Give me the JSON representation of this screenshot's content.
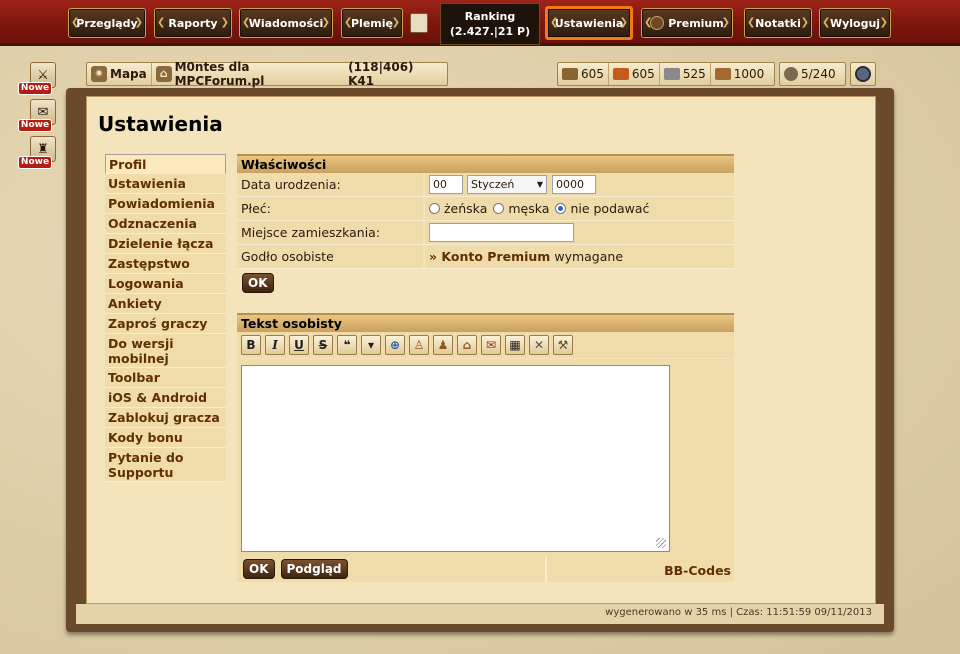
{
  "nav": {
    "buttons": {
      "overviews": "Przeglądy",
      "reports": "Raporty",
      "messages": "Wiadomości",
      "tribe": "Plemię",
      "settings": "Ustawienia",
      "premium": "Premium",
      "notes": "Notatki",
      "logout": "Wyloguj"
    },
    "ranking": {
      "label": "Ranking",
      "value": "(2.427.|21 P)"
    }
  },
  "notices": {
    "badge": "Nowe"
  },
  "village": {
    "map_label": "Mapa",
    "name": "M0ntes dla MPCForum.pl",
    "coords": "(118|406) K41"
  },
  "resources": {
    "wood": "605",
    "clay": "605",
    "iron": "525",
    "storage": "1000",
    "population": "5/240"
  },
  "page": {
    "title": "Ustawienia"
  },
  "menu": {
    "items": [
      "Profil",
      "Ustawienia",
      "Powiadomienia",
      "Odznaczenia",
      "Dzielenie łącza",
      "Zastępstwo",
      "Logowania",
      "Ankiety",
      "Zaproś graczy",
      "Do wersji mobilnej",
      "Toolbar",
      "iOS & Android",
      "Zablokuj gracza",
      "Kody bonu",
      "Pytanie do Supportu"
    ]
  },
  "properties": {
    "header": "Właściwości",
    "birthdate_label": "Data urodzenia:",
    "day": "00",
    "month": "Styczeń",
    "year": "0000",
    "gender_label": "Płeć:",
    "gender_options": [
      "żeńska",
      "męska",
      "nie podawać"
    ],
    "gender_selected": "nie podawać",
    "residence_label": "Miejsce zamieszkania:",
    "residence_value": "",
    "emblem_label": "Godło osobiste",
    "emblem_link": "» Konto Premium",
    "emblem_suffix": "wymagane",
    "ok_label": "OK"
  },
  "personal_text": {
    "header": "Tekst osobisty",
    "toolbar_icons": [
      "bold-icon",
      "italic-icon",
      "underline-icon",
      "strikethrough-icon",
      "quote-icon",
      "spoiler-icon",
      "url-icon",
      "player-icon",
      "tribe-icon",
      "village-icon",
      "report-icon",
      "table-icon",
      "units-icon",
      "building-icon"
    ],
    "toolbar_glyphs": [
      "B",
      "I",
      "U",
      "S",
      "❝",
      "▾",
      "⊕",
      "♙",
      "♟",
      "⌂",
      "✉",
      "▦",
      "✕",
      "⚒"
    ],
    "content": "",
    "ok_label": "OK",
    "preview_label": "Podgląd",
    "bbcodes_label": "BB-Codes"
  },
  "footer": {
    "text": "wygenerowano w 35 ms | Czas: 11:51:59 09/11/2013"
  }
}
